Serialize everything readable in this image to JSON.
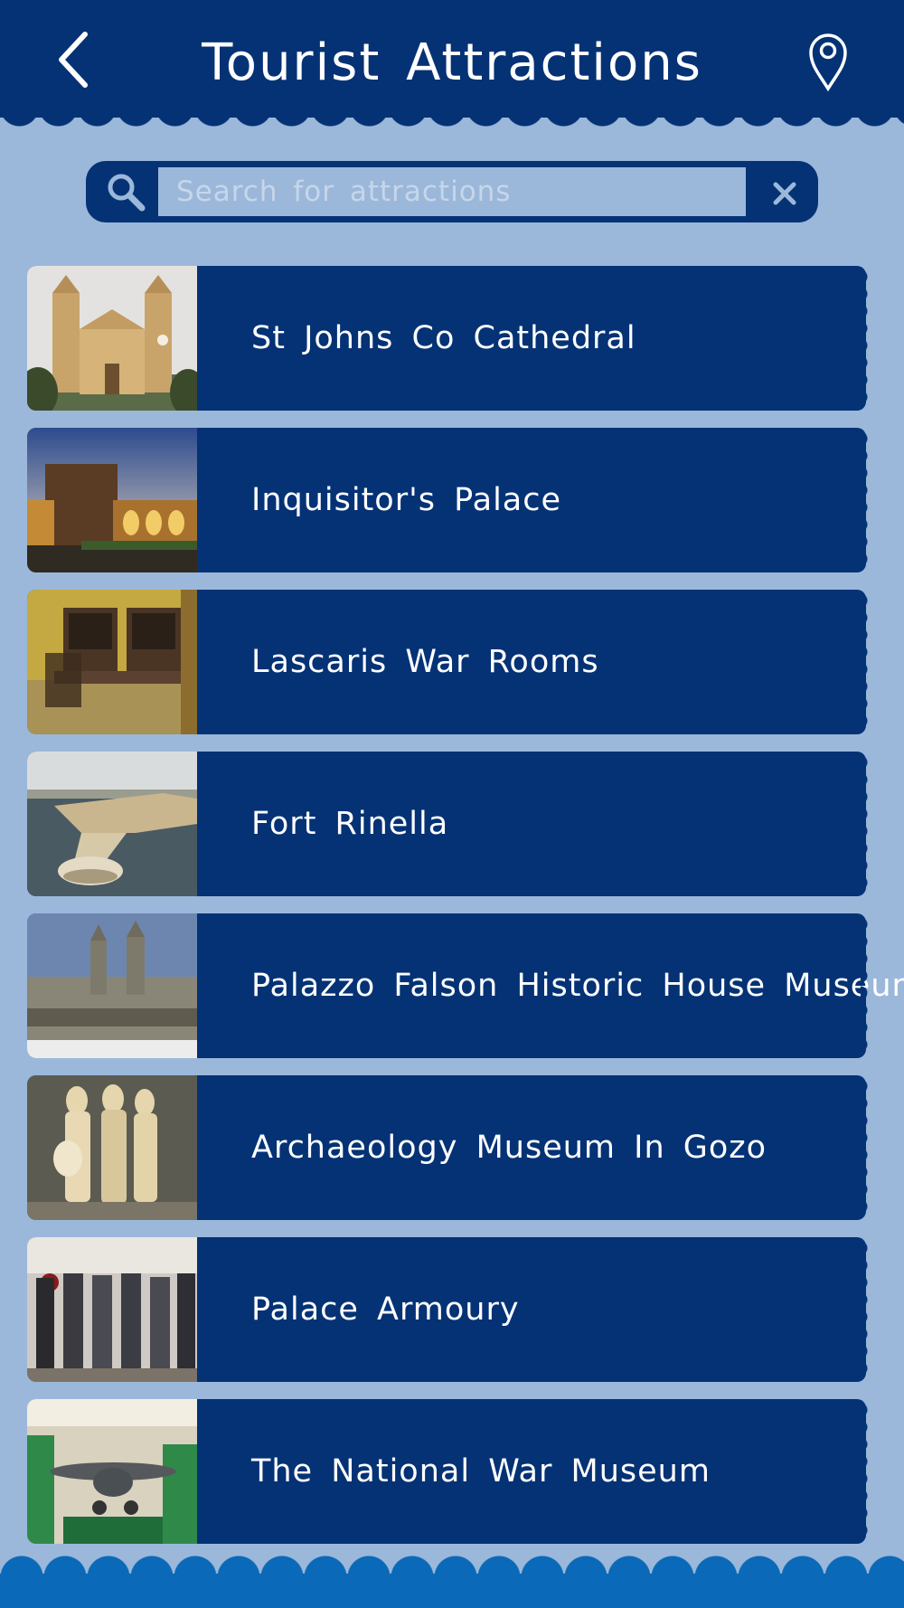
{
  "header": {
    "title": "Tourist Attractions",
    "back_icon": "chevron-left-icon",
    "map_icon": "map-pin-icon"
  },
  "search": {
    "placeholder": "Search for attractions",
    "value": "",
    "search_icon": "search-icon",
    "clear_icon": "close-icon"
  },
  "attractions": [
    {
      "name": "St Johns Co Cathedral"
    },
    {
      "name": "Inquisitor's Palace"
    },
    {
      "name": "Lascaris War Rooms"
    },
    {
      "name": "Fort Rinella"
    },
    {
      "name": "Palazzo Falson Historic House Museum"
    },
    {
      "name": "Archaeology Museum In Gozo"
    },
    {
      "name": "Palace Armoury"
    },
    {
      "name": "The National War Museum"
    }
  ],
  "colors": {
    "header": "#043275",
    "background": "#9bb8da",
    "card": "#043275",
    "footer": "#0a69b8"
  }
}
